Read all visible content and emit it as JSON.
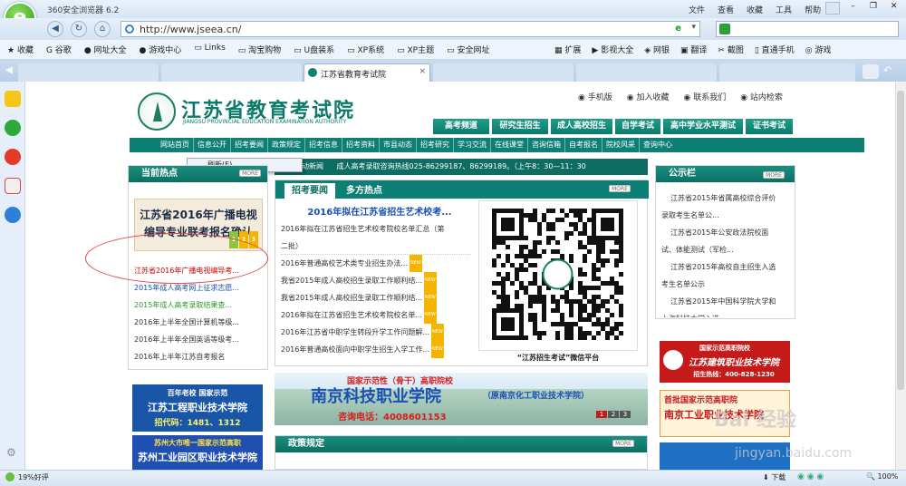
{
  "browser": {
    "title": "360安全浏览器 6.2",
    "menu": [
      "文件",
      "查看",
      "收藏",
      "工具",
      "帮助"
    ],
    "url": "http://www.jseea.cn/",
    "search_placeholder": "",
    "favorites": [
      "收藏",
      "谷歌",
      "网址大全",
      "游戏中心",
      "Links",
      "淘宝购物",
      "U盘装系",
      "XP系统",
      "XP主题",
      "安全网址"
    ],
    "right_tools": [
      "扩展",
      "影视大全",
      "网银",
      "翻译",
      "截图",
      "直通手机",
      "游戏"
    ],
    "active_tab": "江苏省教育考试院",
    "refresh_menu": "刷新(E)",
    "status_left": "19%好评",
    "status_right": [
      "下载",
      "100%"
    ]
  },
  "site": {
    "name_cn": "江苏省教育考试院",
    "name_en": "JIANGSU PROVINCIAL EDUCATION EXAMINATION AUTHORITY",
    "top_links": [
      "手机版",
      "加入收藏",
      "联系我们",
      "站内检索"
    ],
    "channels": [
      "高考频道",
      "研究生招生",
      "成人高校招生",
      "自学考试",
      "高中学业水平测试",
      "证书考试"
    ],
    "subnav": [
      "网站首页",
      "信息公开",
      "招考要闻",
      "政策规定",
      "招考信息",
      "招考资料",
      "市县动态",
      "招考研究",
      "学习交流",
      "在线课堂",
      "咨询信箱",
      "自考报名",
      "院校风采",
      "查询中心"
    ],
    "marquee_label": "动新闻",
    "marquee": "成人高考录取咨询热线025-86299187、86299189。（上午8：30—11：30",
    "hot_title": "当前热点",
    "more": "MORE",
    "hot_banner": "江苏省2016年广播电视编导专业联考报名确认",
    "hot_pages": [
      "1",
      "2",
      "3"
    ],
    "hot_list": [
      {
        "text": "江苏省2016年广播电视编导考...",
        "color": "#d40000"
      },
      {
        "text": "2015年成人高考网上征求志愿...",
        "color": "#1a4fb5"
      },
      {
        "text": "2015年成人高考录取结果查...",
        "color": "#2a9a2a"
      },
      {
        "text": "2016年上半年全国计算机等级...",
        "color": "#333333"
      },
      {
        "text": "2016年上半年全国英语等级考...",
        "color": "#333333"
      },
      {
        "text": "2016年上半年江苏自考报名",
        "color": "#333333"
      }
    ],
    "news_tabs": [
      "招考要闻",
      "多方热点"
    ],
    "news_headline": "2016年拟在江苏省招生艺术校考...",
    "news_list": [
      {
        "text": "2016年拟在江苏省招生艺术校考院校名单汇总（第",
        "new": false
      },
      {
        "text": "二批）",
        "new": false
      },
      {
        "text": "2016年普通高校艺术类专业招生办法...",
        "new": true
      },
      {
        "text": "我省2015年成人高校招生录取工作顺利结...",
        "new": true
      },
      {
        "text": "我省2015年成人高校招生录取工作顺利结...",
        "new": true
      },
      {
        "text": "2016年拟在江苏省招生艺术校考院校名单...",
        "new": true
      },
      {
        "text": "2016年江苏省中职学生转段升学工作问题解...",
        "new": true
      },
      {
        "text": "2016年普通高校面向中职学生招生入学工作...",
        "new": true
      }
    ],
    "new_badge": "NEW",
    "qr_caption": "“江苏招生考试”微信平台",
    "notice_title": "公示栏",
    "notice_list": [
      "江苏省2015年省属高校综合评价",
      "录取考生名单公...",
      "江苏省2015年公安政法院校面",
      "试、体能测试（军检...",
      "江苏省2015年高校自主招生入选",
      "考生名单公示",
      "江苏省2015年中国科学院大学和",
      "上海科技大学入选"
    ],
    "ad_left1": {
      "l1": "百年老校 国家示范",
      "l2": "江苏工程职业技术学院",
      "l3": "招代码：1481、1312"
    },
    "ad_left2": {
      "l1": "苏州大市唯一国家示范高职",
      "l2": "苏州工业园区职业技术学院"
    },
    "ad_center": {
      "l1": "国家示范性（骨干）高职院校",
      "l2": "南京科技职业学院",
      "l3": "（原南京化工职业技术学院）",
      "l4": "咨询电话：4008601153"
    },
    "ad_center_pages": [
      "1",
      "2",
      "3"
    ],
    "ad_right1": {
      "l1": "国家示范高职院校",
      "l2": "江苏建筑职业技术学院",
      "l3": "招生热线：400-828-1230"
    },
    "ad_right2": {
      "l1": "首批国家示范高职院",
      "l2": "南京工业职业技术学院"
    },
    "policy_title": "政策规定",
    "watermark": "jingyan.baidu.com"
  }
}
